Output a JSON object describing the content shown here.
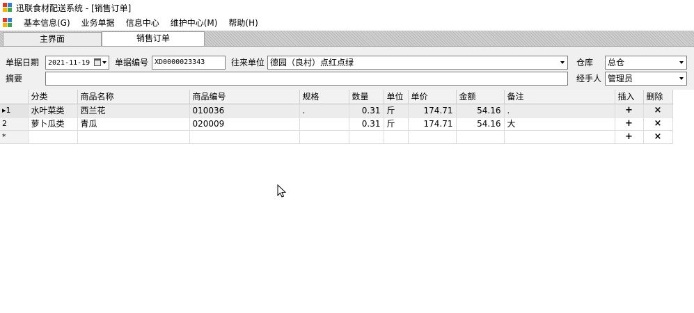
{
  "window": {
    "title": "迅联食材配送系统 - [销售订单]"
  },
  "menu": {
    "items": [
      {
        "label": "基本信息(G)"
      },
      {
        "label": "业务单据"
      },
      {
        "label": "信息中心"
      },
      {
        "label": "维护中心(M)"
      },
      {
        "label": "帮助(H)"
      }
    ]
  },
  "tabs": [
    {
      "label": "主界面",
      "active": false
    },
    {
      "label": "销售订单",
      "active": true
    }
  ],
  "form": {
    "date_label": "单据日期",
    "date_value": "2021-11-19",
    "docno_label": "单据编号",
    "docno_value": "XD0000023343",
    "partner_label": "往来单位",
    "partner_value": "德园（良村）点红点绿",
    "warehouse_label": "仓库",
    "warehouse_value": "总仓",
    "summary_label": "摘要",
    "summary_value": "",
    "handler_label": "经手人",
    "handler_value": "管理员"
  },
  "grid": {
    "columns": [
      "分类",
      "商品名称",
      "商品编号",
      "规格",
      "数量",
      "单位",
      "单价",
      "金额",
      "备注",
      "插入",
      "删除"
    ],
    "rows": [
      {
        "marker": "▸1",
        "category": "水叶菜类",
        "name": "西兰花",
        "code": "010036",
        "spec": ".",
        "qty": "0.31",
        "unit": "斤",
        "price": "174.71",
        "amount": "54.16",
        "note": ".",
        "insert": "+",
        "delete": "×"
      },
      {
        "marker": "2",
        "category": "萝卜瓜类",
        "name": "青瓜",
        "code": "020009",
        "spec": "",
        "qty": "0.31",
        "unit": "斤",
        "price": "174.71",
        "amount": "54.16",
        "note": "大",
        "insert": "+",
        "delete": "×"
      },
      {
        "marker": "*",
        "category": "",
        "name": "",
        "code": "",
        "spec": "",
        "qty": "",
        "unit": "",
        "price": "",
        "amount": "",
        "note": "",
        "insert": "+",
        "delete": "×"
      }
    ]
  }
}
